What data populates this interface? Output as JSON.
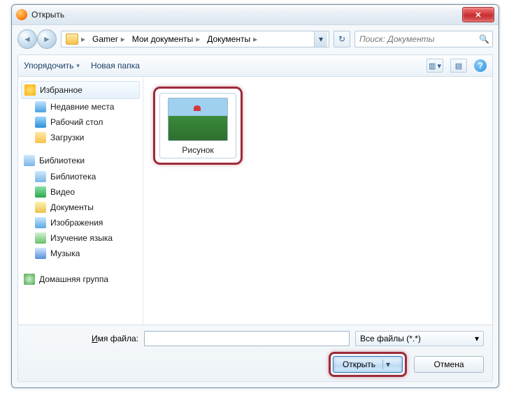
{
  "title": "Открыть",
  "close_glyph": "✕",
  "nav": {
    "back_glyph": "◄",
    "fwd_glyph": "►"
  },
  "breadcrumb": {
    "segments": [
      "Gamer",
      "Мои документы",
      "Документы"
    ],
    "chev": "▸",
    "drop": "▾"
  },
  "refresh_glyph": "↻",
  "search": {
    "placeholder": "Поиск: Документы",
    "mag": "🔍"
  },
  "toolbar": {
    "organize": "Упорядочить",
    "newfolder": "Новая папка",
    "dd": "▾",
    "view_glyph": "▥",
    "pane_glyph": "▤",
    "help_glyph": "?"
  },
  "sidebar": {
    "fav": "Избранное",
    "fav_items": [
      "Недавние места",
      "Рабочий стол",
      "Загрузки"
    ],
    "lib": "Библиотеки",
    "lib_items": [
      "Библиотека",
      "Видео",
      "Документы",
      "Изображения",
      "Изучение языка",
      "Музыка"
    ],
    "home": "Домашняя группа"
  },
  "file": {
    "name": "Рисунок"
  },
  "bottom": {
    "label_prefix": "И",
    "label_rest": "мя файла:",
    "filter": "Все файлы (*.*)",
    "filter_dd": "▾",
    "open": "Открыть",
    "open_dd": "▾",
    "cancel": "Отмена"
  }
}
